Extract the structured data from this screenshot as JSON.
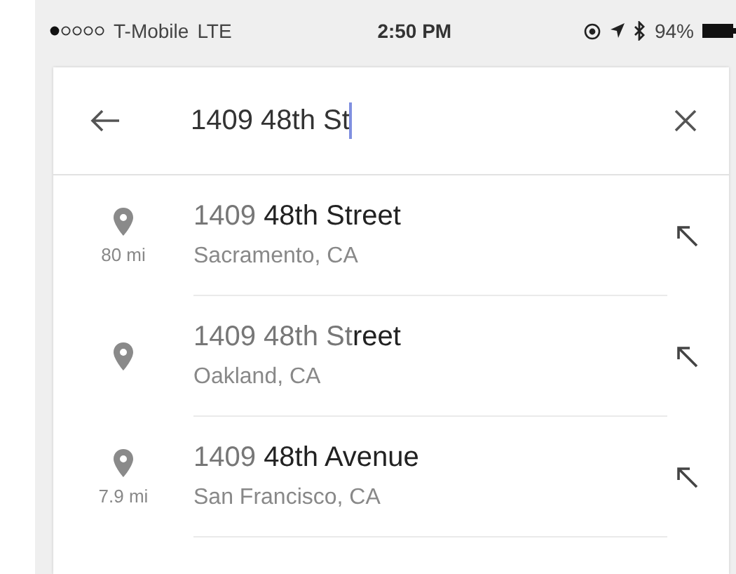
{
  "status_bar": {
    "carrier": "T-Mobile",
    "network": "LTE",
    "time": "2:50 PM",
    "battery": "94%"
  },
  "search": {
    "value": "1409 48th St"
  },
  "suggestions": [
    {
      "title": "1409 **48th Street**",
      "subtitle": "Sacramento, CA",
      "distance": "80 mi"
    },
    {
      "title": "1409 48th St**reet**",
      "subtitle": "Oakland, CA"
    },
    {
      "title": "1409 **48th Avenue**",
      "subtitle": "San Francisco, CA",
      "distance": "7.9 mi"
    }
  ]
}
